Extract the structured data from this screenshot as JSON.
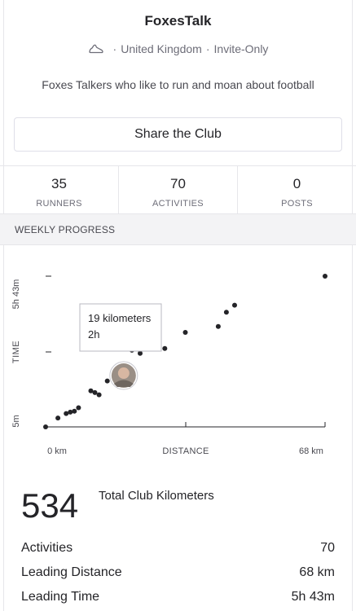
{
  "club": {
    "name": "FoxesTalk",
    "sport_icon": "running-shoe-icon",
    "location": "United Kingdom",
    "access": "Invite-Only",
    "separator": "·",
    "description": "Foxes Talkers who like to run and moan about football"
  },
  "actions": {
    "share_label": "Share the Club"
  },
  "stats": [
    {
      "value": "35",
      "label": "RUNNERS"
    },
    {
      "value": "70",
      "label": "ACTIVITIES"
    },
    {
      "value": "0",
      "label": "POSTS"
    }
  ],
  "weekly": {
    "section_title": "WEEKLY PROGRESS",
    "y_axis_label": "TIME",
    "x_axis_label": "DISTANCE",
    "y_tick_top": "5h 43m",
    "y_tick_bottom": "5m",
    "x_tick_left": "0 km",
    "x_tick_right": "68 km",
    "tooltip_line1": "19 kilometers",
    "tooltip_line2": "2h"
  },
  "chart_data": {
    "type": "scatter",
    "xlabel": "DISTANCE",
    "ylabel": "TIME",
    "x_unit": "km",
    "y_unit": "minutes",
    "xlim": [
      0,
      68
    ],
    "ylim": [
      5,
      343
    ],
    "points": [
      {
        "x": 0,
        "y": 5
      },
      {
        "x": 3,
        "y": 25
      },
      {
        "x": 5,
        "y": 35
      },
      {
        "x": 6,
        "y": 38
      },
      {
        "x": 7,
        "y": 40
      },
      {
        "x": 8,
        "y": 48
      },
      {
        "x": 11,
        "y": 86
      },
      {
        "x": 12,
        "y": 82
      },
      {
        "x": 13,
        "y": 77
      },
      {
        "x": 15,
        "y": 108
      },
      {
        "x": 19,
        "y": 120
      },
      {
        "x": 21,
        "y": 111
      },
      {
        "x": 21,
        "y": 177
      },
      {
        "x": 23,
        "y": 170
      },
      {
        "x": 25,
        "y": 195
      },
      {
        "x": 27,
        "y": 188
      },
      {
        "x": 29,
        "y": 181
      },
      {
        "x": 34,
        "y": 217
      },
      {
        "x": 42,
        "y": 230
      },
      {
        "x": 44,
        "y": 262
      },
      {
        "x": 46,
        "y": 278
      },
      {
        "x": 68,
        "y": 343
      }
    ],
    "highlight": {
      "x": 19,
      "y": 120
    }
  },
  "summary": {
    "total_value": "534",
    "total_label": "Total Club Kilometers",
    "rows": [
      {
        "label": "Activities",
        "value": "70"
      },
      {
        "label": "Leading Distance",
        "value": "68 km"
      },
      {
        "label": "Leading Time",
        "value": "5h 43m"
      }
    ]
  }
}
